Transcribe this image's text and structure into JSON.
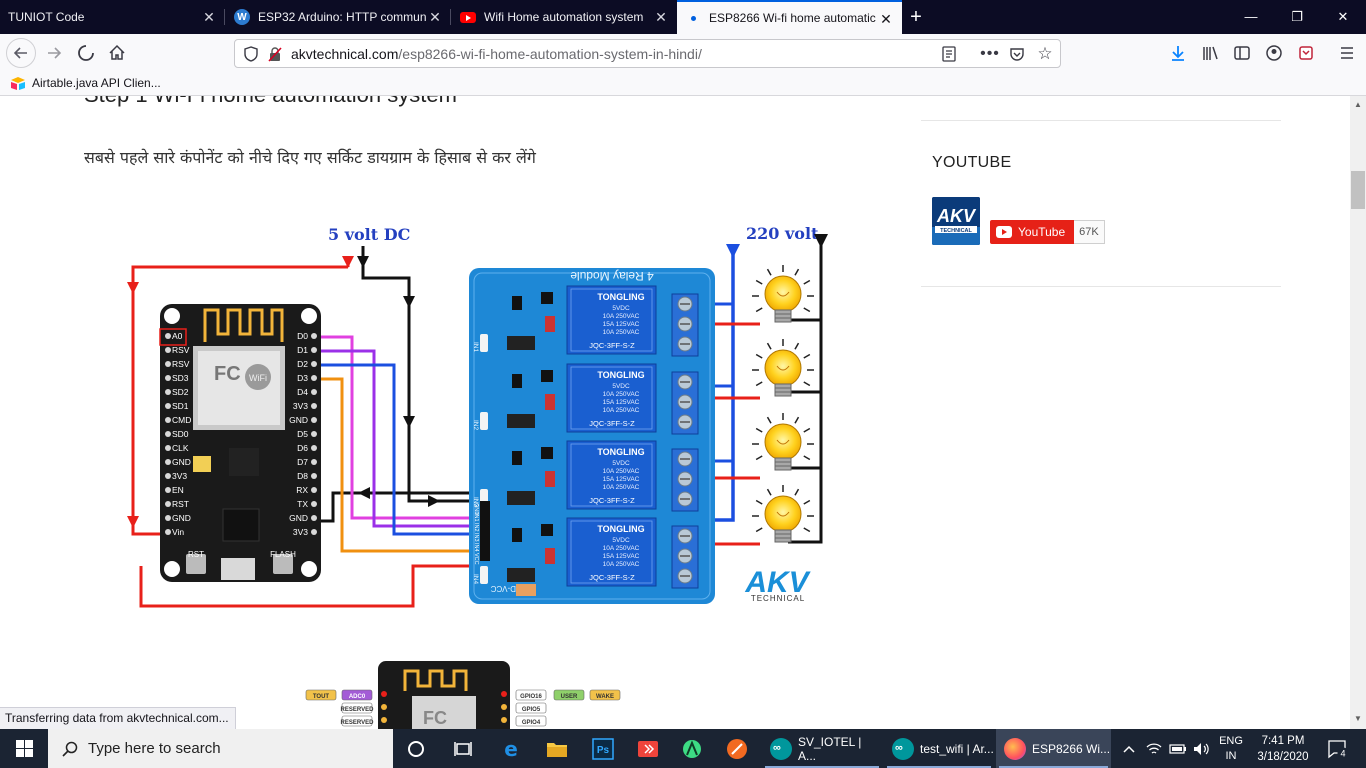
{
  "tabs": [
    {
      "title": "TUNIOT Code",
      "icon": "none"
    },
    {
      "title": "ESP32 Arduino: HTTP commun",
      "icon": "wordpress-icon"
    },
    {
      "title": "Wifi Home automation system",
      "icon": "youtube-icon"
    },
    {
      "title": "ESP8266 Wi-fi home automatic",
      "icon": "loading-dot-icon",
      "active": true
    }
  ],
  "window_controls": {
    "minimize": "—",
    "restore": "❐",
    "close": "✕"
  },
  "nav": {
    "url_domain": "akvtechnical.com",
    "url_path": "/esp8266-wi-fi-home-automation-system-in-hindi/"
  },
  "bookmarks": [
    {
      "label": "Airtable.java API Clien..."
    }
  ],
  "page": {
    "clipped_heading": "Step 1 Wi-Fi home automation system",
    "intro_text": "सबसे पहले सारे कंपोनेंट को नीचे दिए गए सर्किट डायग्राम के हिसाब से कर लेंगे",
    "sidebar": {
      "youtube_heading": "YOUTUBE",
      "youtube_button": "YouTube",
      "subscriber_count": "67K",
      "channel_logo_text": "AKV",
      "channel_logo_sub": "TECHNICAL"
    },
    "diagram": {
      "label_5v": "5 volt DC",
      "label_220v": "220 volt",
      "relay_module_title": "4 Relay Module",
      "relay_brand": "TONGLING",
      "relay_lines": [
        "5VDC",
        "10A 250VAC",
        "15A 125VAC",
        "10A 250VAC"
      ],
      "relay_model": "JQC-3FF-S-Z",
      "relay_inputs": [
        "IN1",
        "IN2",
        "IN3",
        "IN4"
      ],
      "relay_header_pins": [
        "GND",
        "IN1",
        "IN2",
        "IN3",
        "IN4",
        "VCC"
      ],
      "jd_vcc": "JD-VCC",
      "nodemcu_left_pins": [
        "A0",
        "RSV",
        "RSV",
        "SD3",
        "SD2",
        "SD1",
        "CMD",
        "SD0",
        "CLK",
        "GND",
        "3V3",
        "EN",
        "RST",
        "GND",
        "Vin"
      ],
      "nodemcu_right_pins": [
        "D0",
        "D1",
        "D2",
        "D3",
        "D4",
        "3V3",
        "GND",
        "D5",
        "D6",
        "D7",
        "D8",
        "RX",
        "TX",
        "GND",
        "3V3"
      ],
      "nodemcu_buttons": [
        "RST",
        "FLASH"
      ],
      "wifi_logo": "WiFi",
      "akv_logo": "AKV",
      "akv_sub": "TECHNICAL",
      "pinout_left": [
        "TOUT",
        "ADC0",
        "RESERVED",
        "RESERVED"
      ],
      "pinout_right": [
        "GPIO16",
        "USER",
        "WAKE",
        "GPIO5",
        "GPIO4"
      ]
    }
  },
  "status_text": "Transferring data from akvtechnical.com...",
  "taskbar": {
    "search_placeholder": "Type here to search",
    "apps": [
      {
        "label": "SV_IOTEL | A...",
        "icon": "arduino-icon"
      },
      {
        "label": "test_wifi | Ar...",
        "icon": "arduino-icon"
      },
      {
        "label": "ESP8266 Wi...",
        "icon": "firefox-icon",
        "active": true
      }
    ],
    "lang_line1": "ENG",
    "lang_line2": "IN",
    "time": "7:41 PM",
    "date": "3/18/2020",
    "notification_count": "4"
  },
  "colors": {
    "tabbar_bg": "#0c0c24",
    "active_tab_accent": "#0060df",
    "taskbar_bg": "#1b2433",
    "youtube_red": "#e62117",
    "relay_blue": "#1e88d6",
    "wire_red": "#e8201a",
    "wire_blue": "#1b4fe0",
    "wire_purple": "#9b30e8",
    "wire_orange": "#f09010",
    "label_blue": "#2440c0"
  }
}
